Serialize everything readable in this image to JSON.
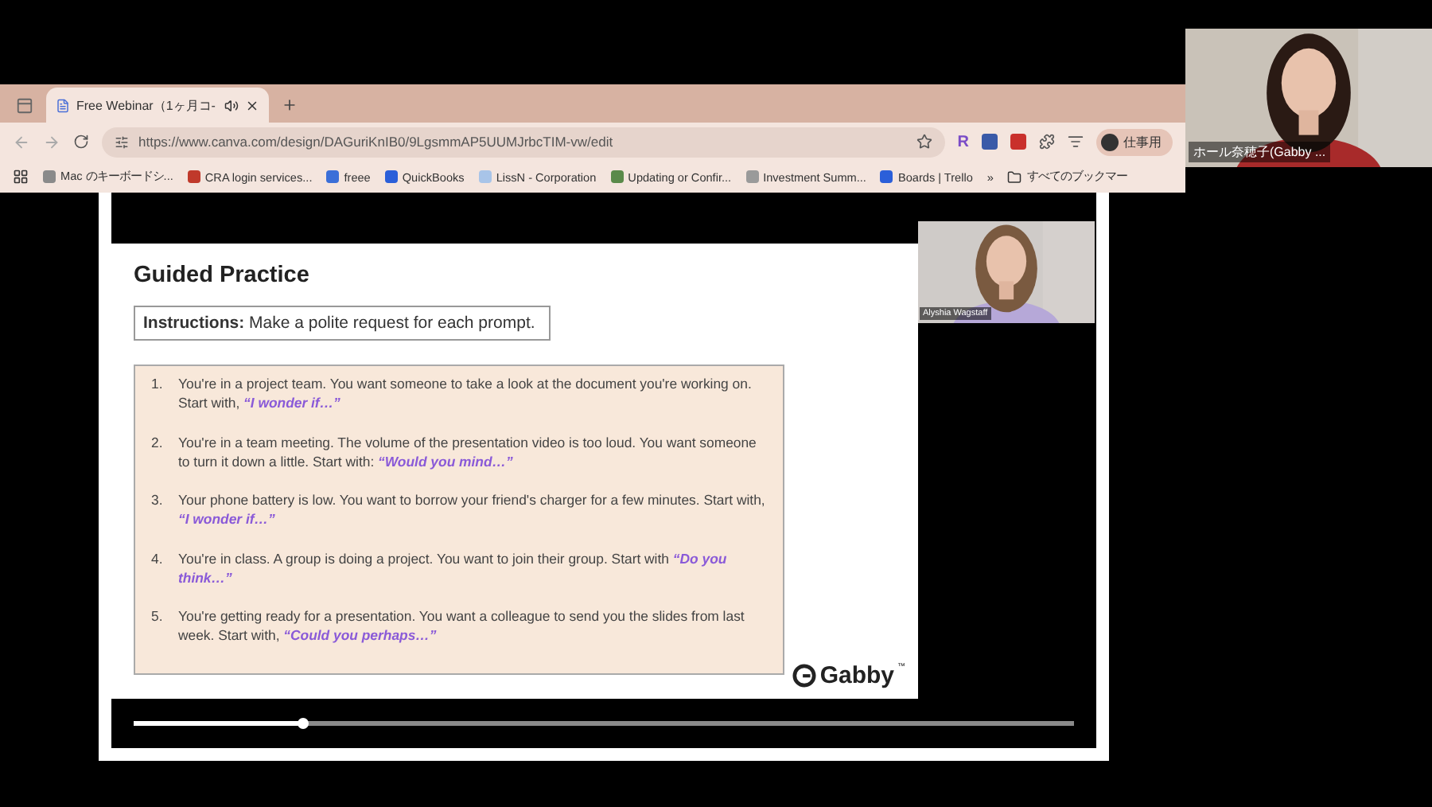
{
  "browser": {
    "tab": {
      "title": "Free Webinar（1ヶ月コ-",
      "selected": true
    },
    "url": "https://www.canva.com/design/DAGuriKnIB0/9LgsmmAP5UUMJrbcTIM-vw/edit",
    "extension_letter": "R",
    "profile": "仕事用",
    "bookmarks": [
      {
        "label": "Mac のキーボードシ...",
        "color": "#8a8a8a"
      },
      {
        "label": "CRA login services...",
        "color": "#c0392b"
      },
      {
        "label": "freee",
        "color": "#3b6fd8"
      },
      {
        "label": "QuickBooks",
        "color": "#2b5fd9"
      },
      {
        "label": "LissN - Corporation",
        "color": "#a8c4e8"
      },
      {
        "label": "Updating or Confir...",
        "color": "#5a8a4a"
      },
      {
        "label": "Investment Summ...",
        "color": "#9a9a9a"
      },
      {
        "label": "Boards | Trello",
        "color": "#2b5fd9"
      }
    ],
    "more": "»",
    "all_bookmarks": "すべてのブックマー"
  },
  "slide": {
    "title": "Guided Practice",
    "instructions_label": "Instructions:",
    "instructions": "Make a polite request for each prompt.",
    "prompts": [
      {
        "number": "1.",
        "text": "You're in a project team. You want someone to take a look at the document you're working on. Start with, ",
        "starter": "“I wonder if…”"
      },
      {
        "number": "2.",
        "text": "You're in a team meeting. The volume of the presentation video is too loud. You want someone to turn it down a little. Start with: ",
        "starter": "“Would you mind…”"
      },
      {
        "number": "3.",
        "text": "Your phone battery is low. You want to borrow your friend's charger for a few minutes. Start with, ",
        "starter": "“I wonder if…”"
      },
      {
        "number": "4.",
        "text": "You're in class. A group is doing a project. You want to join their group. Start with ",
        "starter": "“Do you think…”"
      },
      {
        "number": "5.",
        "text": "You're getting ready for a presentation. You want a colleague to send you the slides from last week. Start with, ",
        "starter": "“Could you perhaps…”"
      }
    ],
    "brand": "Gabby",
    "brand_mark": "™"
  },
  "presenter": {
    "name": "Alyshia Wagstaff"
  },
  "playback": {
    "level": 0.18
  },
  "participant": {
    "name": "ホール奈穂子(Gabby ..."
  }
}
